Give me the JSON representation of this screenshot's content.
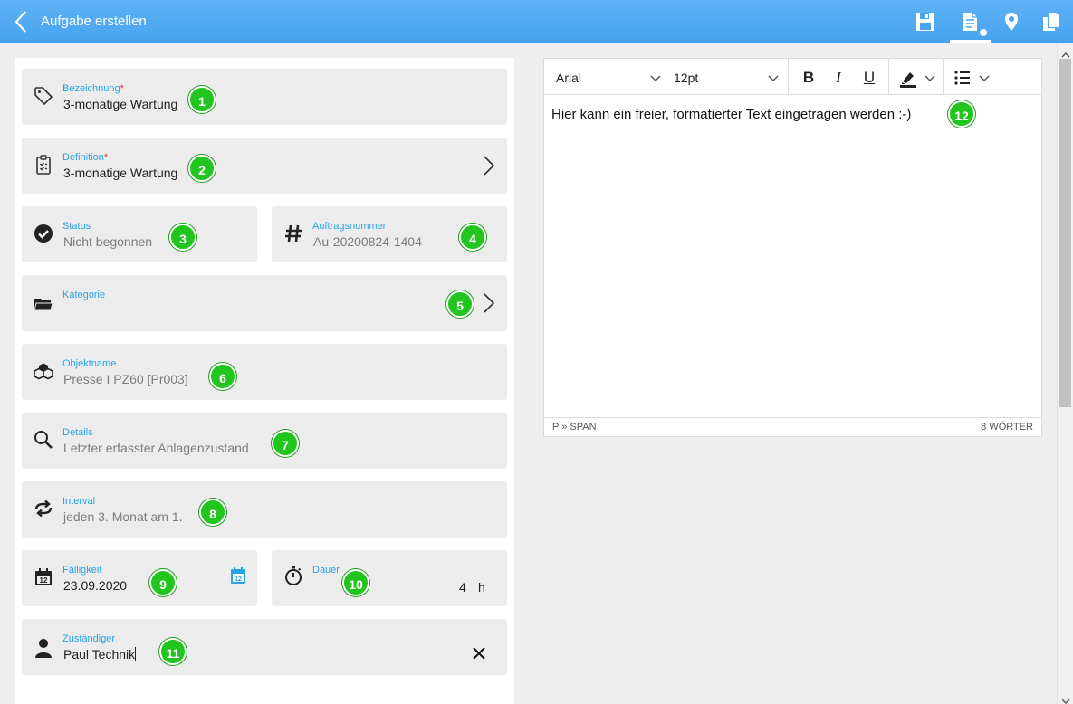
{
  "header": {
    "title": "Aufgabe erstellen",
    "icons": [
      "back-icon",
      "save-icon",
      "document-icon",
      "location-pin-icon",
      "copy-icon"
    ]
  },
  "fields": {
    "bezeichnung": {
      "label": "Bezeichnung",
      "required_mark": "*",
      "value": "3-monatige Wartung",
      "badge": "1"
    },
    "definition": {
      "label": "Definition",
      "required_mark": "*",
      "value": "3-monatige Wartung",
      "badge": "2"
    },
    "status": {
      "label": "Status",
      "value": "Nicht begonnen",
      "badge": "3"
    },
    "auftragsnummer": {
      "label": "Auftragsnummer",
      "value": "Au-20200824-1404",
      "badge": "4"
    },
    "kategorie": {
      "label": "Kategorie",
      "value": "",
      "badge": "5"
    },
    "objektname": {
      "label": "Objektname",
      "value": "Presse I PZ60 [Pr003]",
      "badge": "6"
    },
    "details": {
      "label": "Details",
      "value": "Letzter erfasster Anlagenzustand",
      "badge": "7"
    },
    "interval": {
      "label": "Interval",
      "value": "jeden 3. Monat am 1.",
      "badge": "8"
    },
    "faelligkeit": {
      "label": "Fälligkeit",
      "value": "23.09.2020",
      "badge": "9"
    },
    "dauer": {
      "label": "Dauer",
      "value": "4",
      "unit": "h",
      "badge": "10"
    },
    "zustaendiger": {
      "label": "Zuständiger",
      "value": "Paul Technik",
      "badge": "11"
    }
  },
  "editor": {
    "font": "Arial",
    "size": "12pt",
    "bold": "B",
    "italic": "I",
    "underline": "U",
    "text": "Hier kann ein freier, formatierter Text eingetragen werden :-)",
    "badge": "12",
    "path": "P » SPAN",
    "word_count": "8 WÖRTER"
  },
  "colors": {
    "header": "#4aa4ef",
    "label": "#29a3e6",
    "badge": "#22c41e",
    "required": "#e53935"
  }
}
